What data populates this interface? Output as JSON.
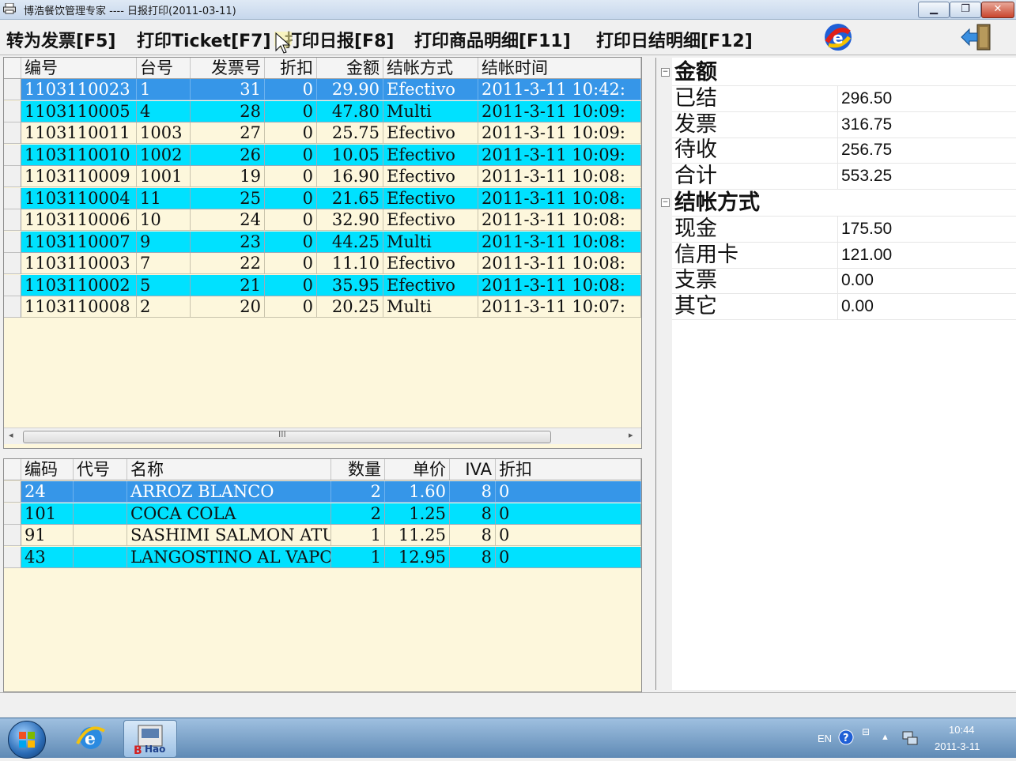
{
  "window": {
    "title": "博浩餐饮管理专家 ---- 日报打印(2011-03-11)"
  },
  "toolbar": {
    "items": [
      "转为发票[F5]",
      "打印Ticket[F7]",
      "打印日报[F8]",
      "打印商品明细[F11]",
      "打印日结明细[F12]"
    ]
  },
  "invoices": {
    "columns": [
      "编号",
      "台号",
      "发票号",
      "折扣",
      "金额",
      "结帐方式",
      "结帐时间"
    ],
    "rows": [
      [
        "1103110023",
        "1",
        "31",
        "0",
        "29.90",
        "Efectivo",
        "2011-3-11 10:42:"
      ],
      [
        "1103110005",
        "4",
        "28",
        "0",
        "47.80",
        "Multi",
        "2011-3-11 10:09:"
      ],
      [
        "1103110011",
        "1003",
        "27",
        "0",
        "25.75",
        "Efectivo",
        "2011-3-11 10:09:"
      ],
      [
        "1103110010",
        "1002",
        "26",
        "0",
        "10.05",
        "Efectivo",
        "2011-3-11 10:09:"
      ],
      [
        "1103110009",
        "1001",
        "19",
        "0",
        "16.90",
        "Efectivo",
        "2011-3-11 10:08:"
      ],
      [
        "1103110004",
        "11",
        "25",
        "0",
        "21.65",
        "Efectivo",
        "2011-3-11 10:08:"
      ],
      [
        "1103110006",
        "10",
        "24",
        "0",
        "32.90",
        "Efectivo",
        "2011-3-11 10:08:"
      ],
      [
        "1103110007",
        "9",
        "23",
        "0",
        "44.25",
        "Multi",
        "2011-3-11 10:08:"
      ],
      [
        "1103110003",
        "7",
        "22",
        "0",
        "11.10",
        "Efectivo",
        "2011-3-11 10:08:"
      ],
      [
        "1103110002",
        "5",
        "21",
        "0",
        "35.95",
        "Efectivo",
        "2011-3-11 10:08:"
      ],
      [
        "1103110008",
        "2",
        "20",
        "0",
        "20.25",
        "Multi",
        "2011-3-11 10:07:"
      ]
    ],
    "scroll_grip": "III"
  },
  "items": {
    "columns": [
      "编码",
      "代号",
      "名称",
      "数量",
      "单价",
      "IVA",
      "折扣"
    ],
    "rows": [
      [
        "24",
        "",
        "ARROZ BLANCO",
        "2",
        "1.60",
        "8",
        "0"
      ],
      [
        "101",
        "",
        "COCA COLA",
        "2",
        "1.25",
        "8",
        "0"
      ],
      [
        "91",
        "",
        "SASHIMI SALMON ATUN",
        "1",
        "11.25",
        "8",
        "0"
      ],
      [
        "43",
        "",
        "LANGOSTINO AL VAPOR",
        "1",
        "12.95",
        "8",
        "0"
      ]
    ]
  },
  "summary": {
    "amount_category": "金额",
    "amount_rows": [
      {
        "name": "已结",
        "value": "296.50"
      },
      {
        "name": "发票",
        "value": "316.75"
      },
      {
        "name": "待收",
        "value": "256.75"
      },
      {
        "name": "合计",
        "value": "553.25"
      }
    ],
    "payment_category": "结帐方式",
    "payment_rows": [
      {
        "name": "现金",
        "value": "175.50"
      },
      {
        "name": "信用卡",
        "value": "121.00"
      },
      {
        "name": "支票",
        "value": "0.00"
      },
      {
        "name": "其它",
        "value": "0.00"
      }
    ]
  },
  "taskbar": {
    "lang": "EN",
    "time": "10:44",
    "date": "2011-3-11"
  },
  "colors": {
    "selected": "#3696e8",
    "alt_row": "#00e1ff",
    "cream": "#fdf7dc"
  }
}
